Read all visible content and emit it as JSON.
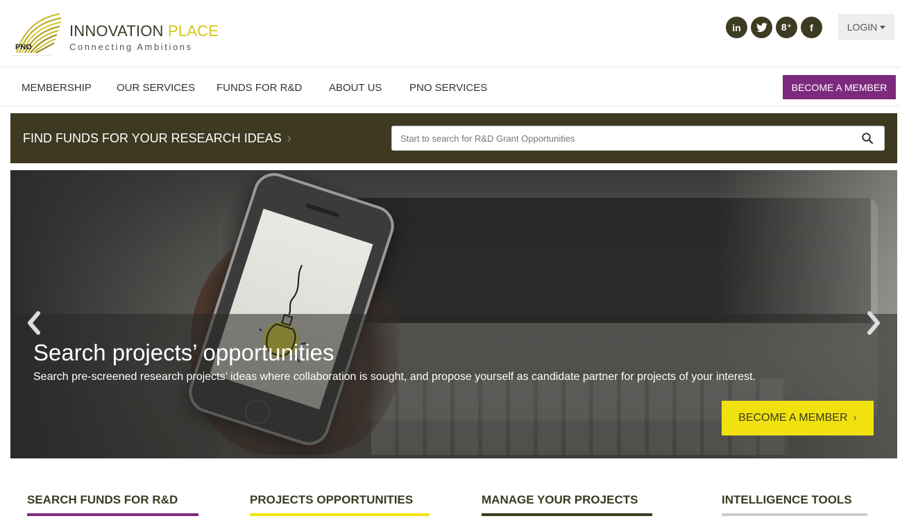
{
  "brand": {
    "mark_label": "PNO",
    "title_part1": "INNOVATION",
    "title_part2": "PLACE",
    "tagline": "Connecting Ambitions",
    "accent_yellow": "#d6c41a",
    "dark_olive": "#3e3a22",
    "purple": "#7d2a7e"
  },
  "social": [
    {
      "name": "linkedin-icon",
      "glyph": "in"
    },
    {
      "name": "twitter-icon",
      "glyph": "t"
    },
    {
      "name": "google-plus-icon",
      "glyph": "8⁺"
    },
    {
      "name": "facebook-icon",
      "glyph": "f"
    }
  ],
  "login_label": "LOGIN",
  "nav": {
    "items": [
      "MEMBERSHIP",
      "OUR SERVICES",
      "FUNDS FOR R&D",
      "ABOUT US",
      "PNO SERVICES"
    ],
    "cta": "BECOME A MEMBER"
  },
  "search": {
    "title": "FIND FUNDS FOR YOUR RESEARCH IDEAS",
    "placeholder": "Start to search for R&D Grant Opportunities"
  },
  "hero": {
    "title": "Search projects’ opportunities",
    "description": "Search pre-screened research projects’ ideas where collaboration is sought, and propose yourself as candidate partner for projects of your interest.",
    "cta": "BECOME A MEMBER"
  },
  "features": [
    {
      "label": "SEARCH FUNDS FOR R&D",
      "color": "#7d2a7e"
    },
    {
      "label": "PROJECTS OPPORTUNITIES",
      "color": "#f1e20f"
    },
    {
      "label": "MANAGE YOUR PROJECTS",
      "color": "#3e3a22"
    },
    {
      "label": "INTELLIGENCE TOOLS",
      "color": "#cccccc"
    }
  ]
}
